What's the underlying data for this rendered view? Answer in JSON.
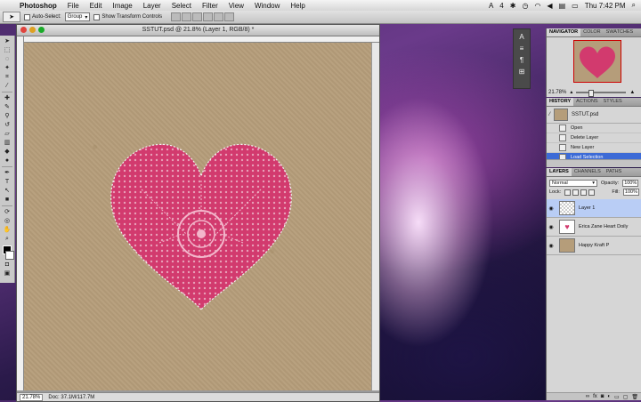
{
  "menubar": {
    "apple": "",
    "items": [
      "Photoshop",
      "File",
      "Edit",
      "Image",
      "Layer",
      "Select",
      "Filter",
      "View",
      "Window",
      "Help"
    ],
    "status_num": "4",
    "clock": "Thu 7:42 PM"
  },
  "options": {
    "auto_select": "Auto-Select:",
    "group": "Group",
    "transform": "Show Transform Controls"
  },
  "document": {
    "title": "SSTUT.psd @ 21.8% (Layer 1, RGB/8) *",
    "zoom": "21.78%",
    "doc_size": "Doc: 37.1M/117.7M"
  },
  "navigator": {
    "tabs": [
      "NAVIGATOR",
      "COLOR",
      "SWATCHES"
    ],
    "zoom": "21.78%"
  },
  "history": {
    "tabs": [
      "HISTORY",
      "ACTIONS",
      "STYLES"
    ],
    "snapshot": "SSTUT.psd",
    "steps": [
      "Open",
      "Delete Layer",
      "New Layer",
      "Load Selection"
    ],
    "active_index": 3
  },
  "layers": {
    "tabs": [
      "LAYERS",
      "CHANNELS",
      "PATHS"
    ],
    "blend": "Normal",
    "opacity_label": "Opacity:",
    "opacity": "100%",
    "lock_label": "Lock:",
    "fill_label": "Fill:",
    "fill": "100%",
    "items": [
      {
        "name": "Layer 1",
        "active": true
      },
      {
        "name": "Erica Zane Heart Doily",
        "active": false
      },
      {
        "name": "Happy Kraft P",
        "active": false
      }
    ]
  },
  "colors": {
    "accent": "#3d6bd6",
    "heart": "#d23a6e",
    "kraft": "#b59d7a"
  }
}
